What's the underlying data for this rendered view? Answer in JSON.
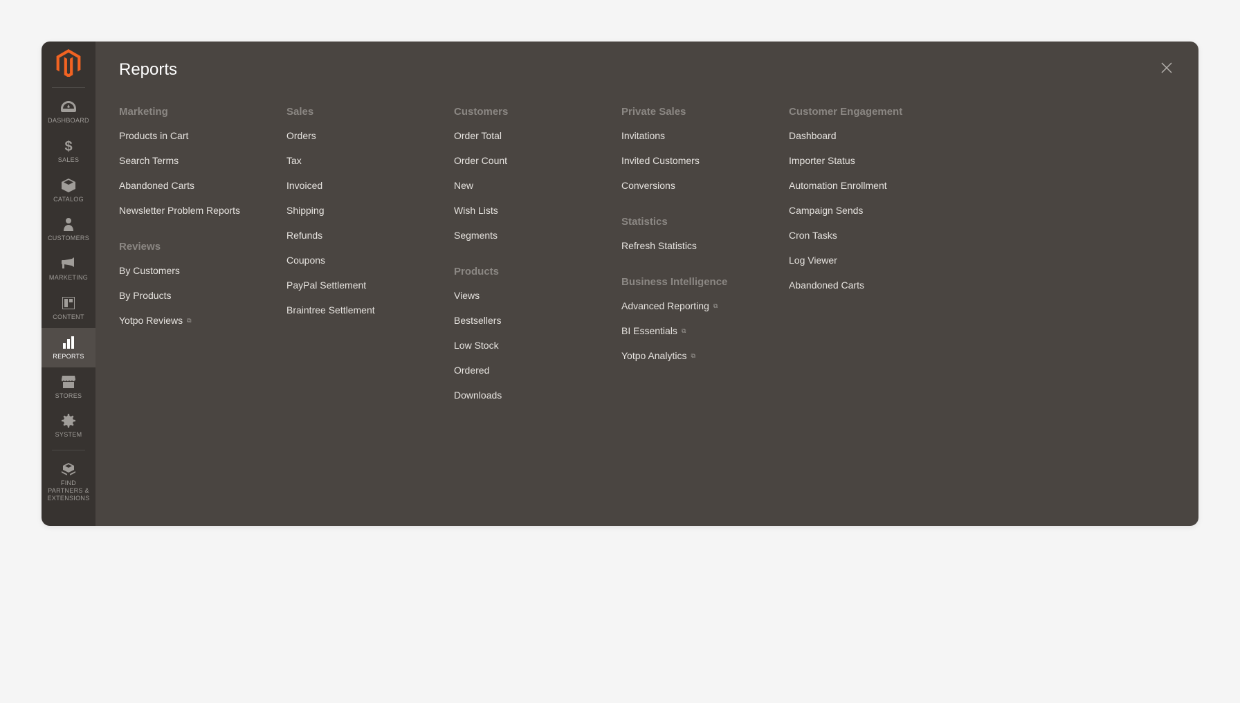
{
  "sidebar": {
    "items": [
      {
        "label": "DASHBOARD"
      },
      {
        "label": "SALES"
      },
      {
        "label": "CATALOG"
      },
      {
        "label": "CUSTOMERS"
      },
      {
        "label": "MARKETING"
      },
      {
        "label": "CONTENT"
      },
      {
        "label": "REPORTS"
      },
      {
        "label": "STORES"
      },
      {
        "label": "SYSTEM"
      },
      {
        "label": "FIND PARTNERS & EXTENSIONS"
      }
    ]
  },
  "flyout": {
    "title": "Reports",
    "columns": [
      [
        {
          "title": "Marketing",
          "items": [
            {
              "label": "Products in Cart"
            },
            {
              "label": "Search Terms"
            },
            {
              "label": "Abandoned Carts"
            },
            {
              "label": "Newsletter Problem Reports"
            }
          ]
        },
        {
          "title": "Reviews",
          "items": [
            {
              "label": "By Customers"
            },
            {
              "label": "By Products"
            },
            {
              "label": "Yotpo Reviews",
              "external": true
            }
          ]
        }
      ],
      [
        {
          "title": "Sales",
          "items": [
            {
              "label": "Orders"
            },
            {
              "label": "Tax"
            },
            {
              "label": "Invoiced"
            },
            {
              "label": "Shipping"
            },
            {
              "label": "Refunds"
            },
            {
              "label": "Coupons"
            },
            {
              "label": "PayPal Settlement"
            },
            {
              "label": "Braintree Settlement"
            }
          ]
        }
      ],
      [
        {
          "title": "Customers",
          "items": [
            {
              "label": "Order Total"
            },
            {
              "label": "Order Count"
            },
            {
              "label": "New"
            },
            {
              "label": "Wish Lists"
            },
            {
              "label": "Segments"
            }
          ]
        },
        {
          "title": "Products",
          "items": [
            {
              "label": "Views"
            },
            {
              "label": "Bestsellers"
            },
            {
              "label": "Low Stock"
            },
            {
              "label": "Ordered"
            },
            {
              "label": "Downloads"
            }
          ]
        }
      ],
      [
        {
          "title": "Private Sales",
          "items": [
            {
              "label": "Invitations"
            },
            {
              "label": "Invited Customers"
            },
            {
              "label": "Conversions"
            }
          ]
        },
        {
          "title": "Statistics",
          "items": [
            {
              "label": "Refresh Statistics"
            }
          ]
        },
        {
          "title": "Business Intelligence",
          "items": [
            {
              "label": "Advanced Reporting",
              "external": true
            },
            {
              "label": "BI Essentials",
              "external": true
            },
            {
              "label": "Yotpo Analytics",
              "external": true
            }
          ]
        }
      ],
      [
        {
          "title": "Customer Engagement",
          "items": [
            {
              "label": "Dashboard"
            },
            {
              "label": "Importer Status"
            },
            {
              "label": "Automation Enrollment"
            },
            {
              "label": "Campaign Sends"
            },
            {
              "label": "Cron Tasks"
            },
            {
              "label": "Log Viewer"
            },
            {
              "label": "Abandoned Carts"
            }
          ]
        }
      ]
    ]
  }
}
